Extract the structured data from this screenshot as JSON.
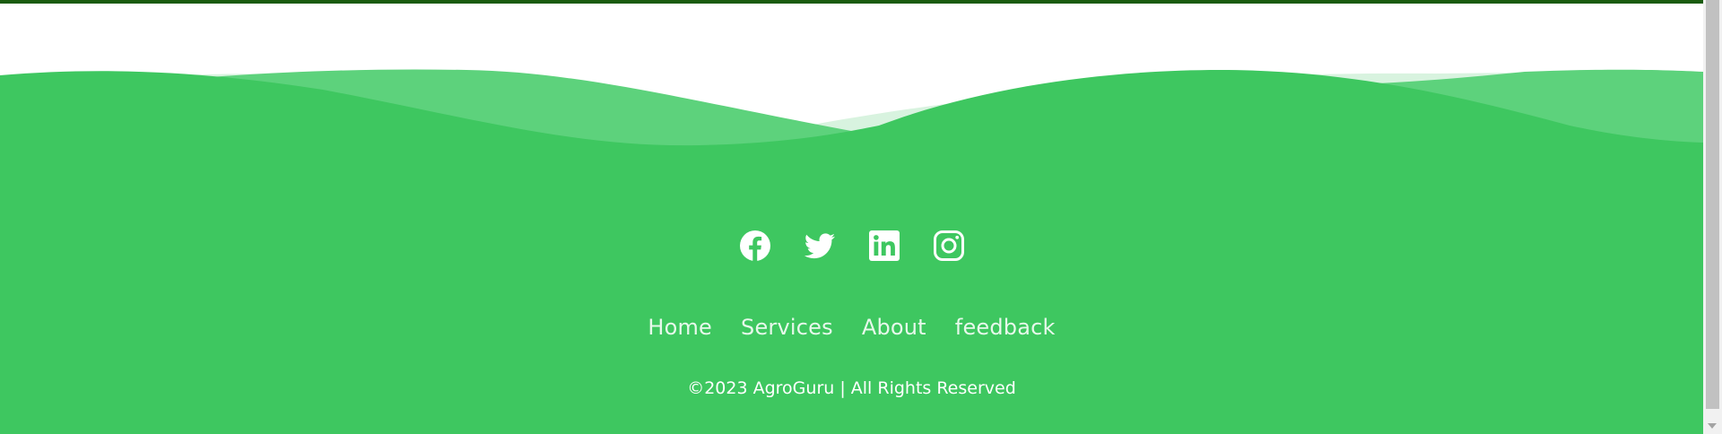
{
  "colors": {
    "footer_green": "#3ec760",
    "wave_light": "#5dd27c",
    "wave_faint": "#d8f3df",
    "top_border": "#1a5c0f",
    "nav_text": "#e7f8eb",
    "copyright_text": "#ffffff",
    "icon_color": "#ffffff"
  },
  "social": [
    {
      "icon": "facebook-icon"
    },
    {
      "icon": "twitter-icon"
    },
    {
      "icon": "linkedin-icon"
    },
    {
      "icon": "instagram-icon"
    }
  ],
  "nav": {
    "items": [
      "Home",
      "Services",
      "About",
      "feedback"
    ]
  },
  "copyright": "©2023 AgroGuru | All Rights Reserved"
}
